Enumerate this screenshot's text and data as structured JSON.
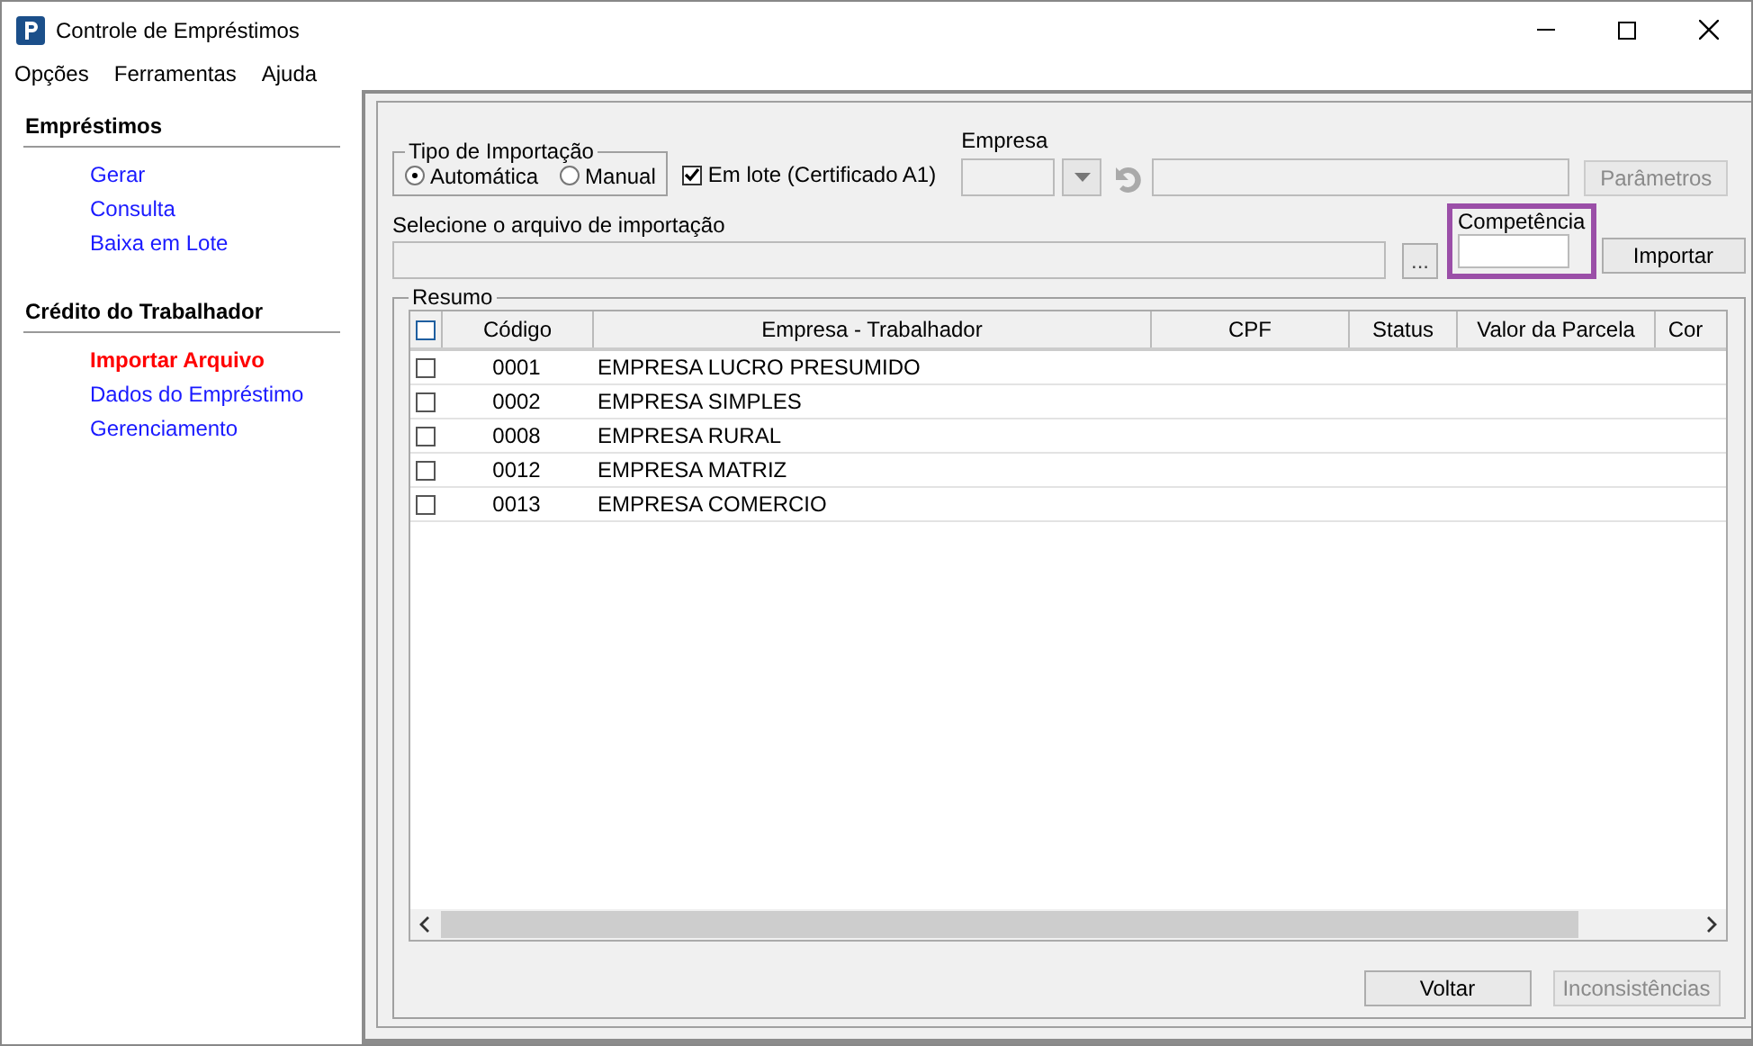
{
  "window": {
    "title": "Controle de Empréstimos"
  },
  "menu": [
    "Opções",
    "Ferramentas",
    "Ajuda"
  ],
  "sidebar": [
    {
      "title": "Empréstimos",
      "items": [
        {
          "label": "Gerar",
          "selected": false
        },
        {
          "label": "Consulta",
          "selected": false
        },
        {
          "label": "Baixa em Lote",
          "selected": false
        }
      ]
    },
    {
      "title": "Crédito do Trabalhador",
      "items": [
        {
          "label": "Importar Arquivo",
          "selected": true
        },
        {
          "label": "Dados do Empréstimo",
          "selected": false
        },
        {
          "label": "Gerenciamento",
          "selected": false
        }
      ]
    }
  ],
  "import_type": {
    "label": "Tipo de Importação",
    "options": [
      {
        "label": "Automática",
        "selected": true
      },
      {
        "label": "Manual",
        "selected": false
      }
    ]
  },
  "batch": {
    "label": "Em lote (Certificado A1)",
    "checked": true
  },
  "empresa": {
    "label": "Empresa"
  },
  "parametros_button": {
    "label": "Parâmetros",
    "disabled": true
  },
  "file": {
    "label": "Selecione o arquivo de importação",
    "browse": "..."
  },
  "competencia": {
    "label": "Competência"
  },
  "importar_button": {
    "label": "Importar",
    "disabled": false
  },
  "resumo": {
    "label": "Resumo",
    "select_all": {
      "checked": false
    },
    "columns": [
      "Código",
      "Empresa - Trabalhador",
      "CPF",
      "Status",
      "Valor da Parcela",
      "Cor"
    ],
    "rows": [
      {
        "checked": false,
        "code": "0001",
        "name": "EMPRESA LUCRO PRESUMIDO"
      },
      {
        "checked": false,
        "code": "0002",
        "name": "EMPRESA SIMPLES"
      },
      {
        "checked": false,
        "code": "0008",
        "name": "EMPRESA RURAL"
      },
      {
        "checked": false,
        "code": "0012",
        "name": "EMPRESA MATRIZ"
      },
      {
        "checked": false,
        "code": "0013",
        "name": "EMPRESA COMERCIO"
      }
    ]
  },
  "buttons": [
    {
      "label": "Voltar",
      "disabled": false
    },
    {
      "label": "Inconsistências",
      "disabled": true
    }
  ]
}
